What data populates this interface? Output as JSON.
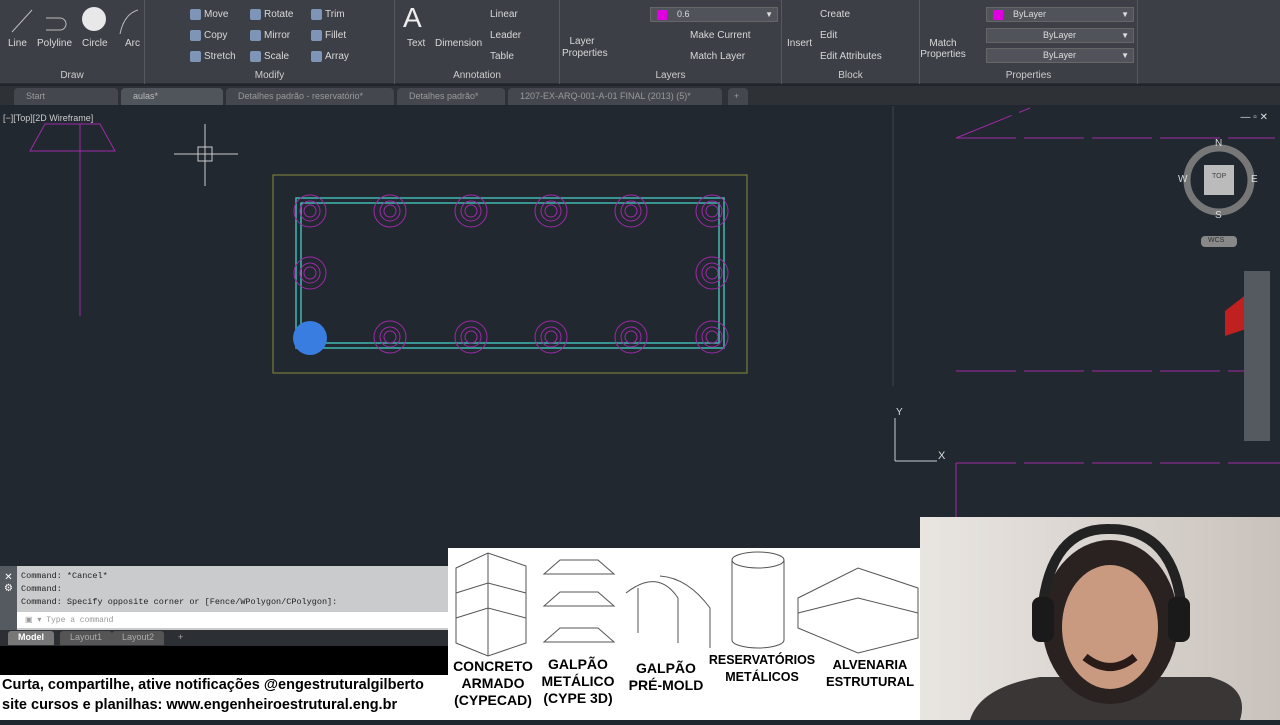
{
  "ribbon": {
    "draw": {
      "title": "Draw",
      "line": "Line",
      "polyline": "Polyline",
      "circle": "Circle",
      "arc": "Arc"
    },
    "modify": {
      "title": "Modify",
      "move": "Move",
      "rotate": "Rotate",
      "trim": "Trim",
      "copy": "Copy",
      "mirror": "Mirror",
      "fillet": "Fillet",
      "stretch": "Stretch",
      "scale": "Scale",
      "array": "Array"
    },
    "annotation": {
      "title": "Annotation",
      "text": "Text",
      "dimension": "Dimension",
      "linear": "Linear",
      "leader": "Leader",
      "table": "Table"
    },
    "layers": {
      "title": "Layers",
      "layer_properties": "Layer Properties",
      "current_layer": "0.6",
      "make_current": "Make Current",
      "match_layer": "Match Layer"
    },
    "block": {
      "title": "Block",
      "insert": "Insert",
      "create": "Create",
      "edit": "Edit",
      "edit_attributes": "Edit Attributes"
    },
    "properties": {
      "title": "Properties",
      "match_properties": "Match Properties",
      "color": "ByLayer",
      "linetype": "ByLayer",
      "lineweight": "ByLayer"
    }
  },
  "doc_tabs": [
    "Start",
    "aulas*",
    "Detalhes padrão - reservatório*",
    "Detalhes padrão*",
    "1207-EX-ARQ-001-A-01 FINAL (2013) (5)*"
  ],
  "viewport": {
    "label": "[−][Top][2D Wireframe]",
    "viewcube": {
      "top": "TOP",
      "n": "N",
      "s": "S",
      "e": "E",
      "w": "W",
      "wcs": "WCS"
    },
    "ucs_x": "X",
    "ucs_y": "Y"
  },
  "command": {
    "history": [
      "Command: *Cancel*",
      "Command:",
      "Command: Specify opposite corner or [Fence/WPolygon/CPolygon]:"
    ],
    "placeholder": "Type a command"
  },
  "layout_tabs": [
    "Model",
    "Layout1",
    "Layout2"
  ],
  "footer": {
    "line1": "Curta, compartilhe, ative notificações @engestruturalgilberto",
    "line2": "site cursos e planilhas: www.engenheiroestrutural.eng.br"
  },
  "banner": [
    {
      "l1": "CONCRETO",
      "l2": "ARMADO",
      "l3": "(CYPECAD)"
    },
    {
      "l1": "GALPÃO",
      "l2": "METÁLICO",
      "l3": "(CYPE 3D)"
    },
    {
      "l1": "GALPÃO",
      "l2": "PRÉ-MOLD"
    },
    {
      "l1": "RESERVATÓRIOS",
      "l2": "METÁLICOS"
    },
    {
      "l1": "ALVENARIA",
      "l2": "ESTRUTURAL"
    }
  ],
  "colors": {
    "layer": "#e000e0",
    "cyan": "#3fb8b0",
    "magenta": "#a02aa8",
    "frame": "#8c8a3a"
  }
}
